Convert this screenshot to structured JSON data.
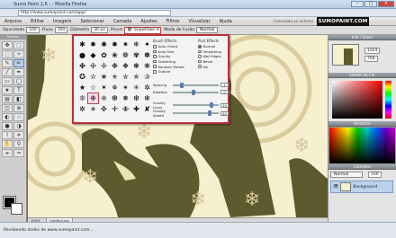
{
  "window": {
    "title": "Sumo Paint 1.6 - - Mozilla Firefox",
    "min": "–",
    "max": "□",
    "close": "✕"
  },
  "browser": {
    "url": "http://www.sumopaint.com/app/"
  },
  "menubar": {
    "items": [
      "Arquivo",
      "Editar",
      "Imagem",
      "Selecionar",
      "Camada",
      "Ajustes",
      "Filtros",
      "Visualizar",
      "Ajuda"
    ],
    "note": "Conectado ao sistema",
    "logo": "SUMOPAINT.COM"
  },
  "tool_options": {
    "opacity_label": "Opacidade",
    "opacity_value": "100",
    "flow_label": "Fluxo",
    "flow_value": "100",
    "diameter_label": "Diâmetro",
    "diameter_value": "30 px",
    "brush_label": "Pincel",
    "brush_value": "Snowflake",
    "mode_label": "Modo de Fusão",
    "mode_value": "Normal"
  },
  "tools_header": "Ferram.",
  "brush_popup": {
    "brush_glyphs": [
      "✱",
      "✹",
      "✺",
      "✸",
      "✷",
      "❄",
      "✦",
      "●",
      "◆",
      "✿",
      "❀",
      "❁",
      "✾",
      "✽",
      "✤",
      "✣",
      "✢",
      "✥",
      "❖",
      "❃",
      "❋",
      "✪",
      "✫",
      "✬",
      "✭",
      "✮",
      "✯",
      "✰",
      "★",
      "☆",
      "✶",
      "✵",
      "✴",
      "✳",
      "✲",
      "❊",
      "❉",
      "❈",
      "❆",
      "❅",
      "❇",
      "✻",
      "✼",
      "☀",
      "✜",
      "✛",
      "✙",
      "✚",
      "✘"
    ],
    "selected_index": 36,
    "brush_effects_header": "Brush Effects",
    "brush_effects": [
      {
        "label": "Auto Orient",
        "checked": false
      },
      {
        "label": "Auto Size",
        "checked": false
      },
      {
        "label": "Gravity",
        "checked": false
      },
      {
        "label": "Scattering",
        "checked": false
      },
      {
        "label": "Random Rotate",
        "checked": false
      },
      {
        "label": "Outline",
        "checked": false
      }
    ],
    "post_effects_header": "Post Effects",
    "post_effects": [
      {
        "label": "Normal",
        "selected": true
      },
      {
        "label": "Smoothing",
        "selected": false
      },
      {
        "label": "Wet Edges",
        "selected": false
      },
      {
        "label": "Bevel",
        "selected": false
      },
      {
        "label": "Ink",
        "selected": false
      }
    ],
    "spacing_label": "Spacing",
    "spacing_value": "1",
    "spacing_level": 0.2,
    "rotation_label": "Rotation",
    "rotation_value": "0",
    "rotation_level": 0.45,
    "gravity_level_label": "Gravity Level",
    "gravity_level_value": "45",
    "gravity_level_level": 0.85,
    "gravity_speed_label": "Gravity Speed",
    "gravity_speed_value": "40",
    "gravity_speed_level": 0.8
  },
  "panels": {
    "info_title": "Info / Zoom",
    "info_w": "1024",
    "info_h": "768",
    "color_title": "Seletor de Cor",
    "samples_title": "Amostras",
    "layers_title": "Camadas",
    "layers_mode": "Normal",
    "layers_opacity": "100",
    "layer_name": "Background"
  },
  "doc_tabs": [
    "100%",
    "Untitled.jpg"
  ],
  "status": {
    "text": "Recebendo dados de www.sumopaint.com..."
  },
  "colors": {
    "accent": "#b8303a",
    "canvas": "#f7f0cf",
    "paint": "#5c5a2e"
  }
}
